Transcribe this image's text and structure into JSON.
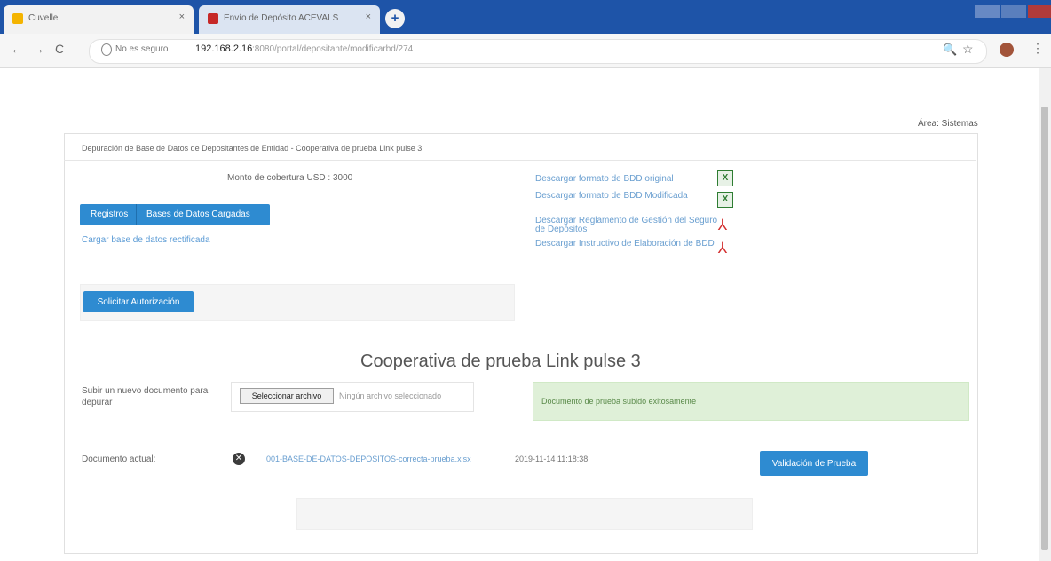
{
  "browser": {
    "tabs": [
      {
        "label": "Cuvelle",
        "close": "×"
      },
      {
        "label": "Envío de Depósito ACEVALS",
        "close": "×"
      }
    ],
    "new_tab": "+",
    "nav": {
      "back": "←",
      "forward": "→",
      "reload": "C"
    },
    "address": {
      "security": "No es seguro",
      "url": "192.168.2.16",
      "url_rest": ":8080/portal/depositante/modificarbd/274"
    },
    "icons": {
      "zoom": "zoom-icon",
      "star": "star-icon",
      "menu": "menu-icon"
    },
    "menu_glyph": "⋮",
    "zoom_glyph": "🔍",
    "star_glyph": "☆"
  },
  "header": {
    "user_area": "Área: Sistemas"
  },
  "panel": {
    "title": "Depuración de Base de Datos de Depositantes de Entidad - Cooperativa de prueba Link pulse 3"
  },
  "left": {
    "amount": "Monto de cobertura USD : 3000",
    "tabs": [
      "Registros",
      "Bases de Datos Cargadas"
    ],
    "upload_link": "Cargar base de datos rectificada"
  },
  "downloads": [
    {
      "label": "Descargar formato de BDD original",
      "icon": "xls-icon",
      "glyph": "X"
    },
    {
      "label": "Descargar formato de BDD Modificada",
      "icon": "xls-icon",
      "glyph": "X"
    },
    {
      "label": "Descargar Reglamento de Gestión del Seguro de Depósitos",
      "icon": "pdf-icon",
      "glyph": "⅄"
    },
    {
      "label": "Descargar Instructivo de Elaboración de BDD",
      "icon": "pdf-icon",
      "glyph": "⅄"
    }
  ],
  "auth": {
    "button": "Solicitar Autorización"
  },
  "coop_title": "Cooperativa de prueba Link pulse 3",
  "upload": {
    "label": "Subir un nuevo documento para depurar",
    "button": "Seleccionar archivo",
    "status": "Ningún archivo seleccionado"
  },
  "success": "Documento de prueba subido exitosamente",
  "current": {
    "label": "Documento actual:",
    "delete_glyph": "✕",
    "file": "001-BASE-DE-DATOS-DEPOSITOS-correcta-prueba.xlsx",
    "date": "2019-11-14 11:18:38",
    "validate_button": "Validación de Prueba"
  },
  "colors": {
    "tabbar": "#1e54a8",
    "primary": "#2e8bd1",
    "success_bg": "#dff0d8",
    "link": "#6a9fd0"
  }
}
